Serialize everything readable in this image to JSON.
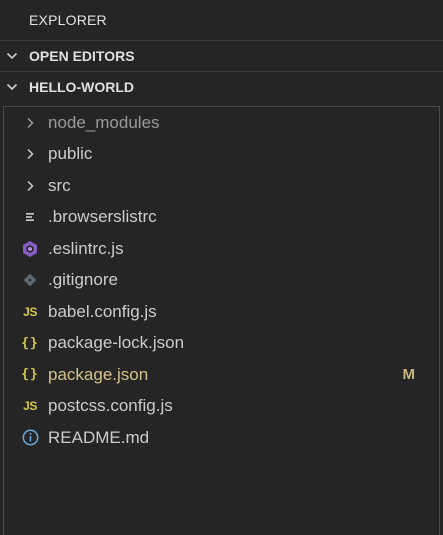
{
  "panel": {
    "title": "EXPLORER"
  },
  "sections": {
    "open_editors": "OPEN EDITORS",
    "project": "HELLO-WORLD"
  },
  "tree": [
    {
      "label": "node_modules",
      "icon": "chevron-right-icon",
      "kind": "folder",
      "dim": true
    },
    {
      "label": "public",
      "icon": "chevron-right-icon",
      "kind": "folder"
    },
    {
      "label": "src",
      "icon": "chevron-right-icon",
      "kind": "folder"
    },
    {
      "label": ".browserslistrc",
      "icon": "lines-file-icon",
      "kind": "file"
    },
    {
      "label": ".eslintrc.js",
      "icon": "eslint-icon",
      "kind": "file"
    },
    {
      "label": ".gitignore",
      "icon": "git-icon",
      "kind": "file"
    },
    {
      "label": "babel.config.js",
      "icon": "js-icon",
      "kind": "file"
    },
    {
      "label": "package-lock.json",
      "icon": "json-icon",
      "kind": "file"
    },
    {
      "label": "package.json",
      "icon": "json-icon",
      "kind": "file",
      "modified": true,
      "badge": "M"
    },
    {
      "label": "postcss.config.js",
      "icon": "js-icon",
      "kind": "file"
    },
    {
      "label": "README.md",
      "icon": "info-icon",
      "kind": "file"
    }
  ],
  "colors": {
    "background": "#252526",
    "text": "#cccccc",
    "modified": "#d7c28b",
    "js": "#d7c84b",
    "eslint": "#9b6cd6",
    "info": "#6aa7d8"
  }
}
